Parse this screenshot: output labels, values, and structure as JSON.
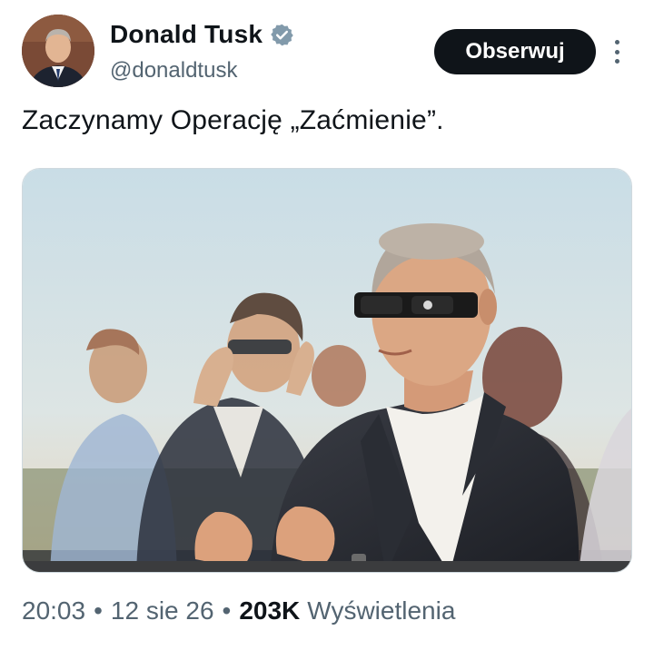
{
  "author": {
    "display_name": "Donald Tusk",
    "handle": "@donaldtusk",
    "verified": true,
    "avatar": "profile-photo",
    "verified_badge_color": "#829aab"
  },
  "actions": {
    "follow_label": "Obserwuj",
    "more_icon": "more-vertical-icon"
  },
  "post": {
    "text": "Zaczynamy Operację „Zaćmienie”.",
    "image": "photo-men-wearing-eclipse-glasses-at-sunset"
  },
  "meta": {
    "time": "20:03",
    "separator": "•",
    "date": "12 sie 26",
    "views_count": "203K",
    "views_label": "Wyświetlenia"
  },
  "colors": {
    "text_primary": "#0f1419",
    "text_secondary": "#536471",
    "follow_bg": "#0f1419",
    "follow_text": "#ffffff"
  }
}
